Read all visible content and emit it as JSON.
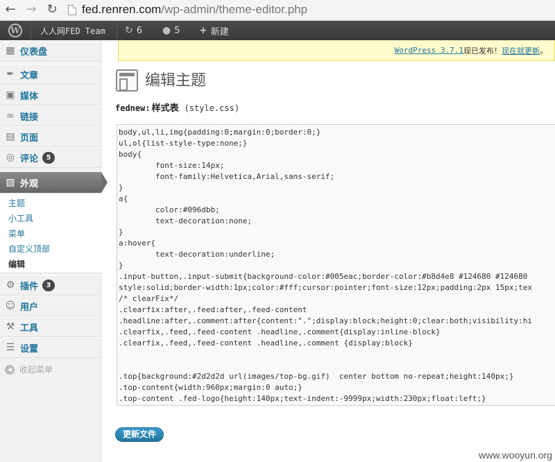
{
  "browser": {
    "url_host": "fed.renren.com",
    "url_path": "/wp-admin/theme-editor.php"
  },
  "adminbar": {
    "logo": "W",
    "site_name": "人人网FED Team",
    "updates_count": "6",
    "comments_count": "5",
    "new_label": "新建"
  },
  "sidebar": {
    "items": [
      {
        "label": "仪表盘"
      },
      {
        "label": "文章"
      },
      {
        "label": "媒体"
      },
      {
        "label": "链接"
      },
      {
        "label": "页面"
      },
      {
        "label": "评论",
        "badge": "5"
      },
      {
        "label": "外观"
      },
      {
        "label": "插件",
        "badge": "3"
      },
      {
        "label": "用户"
      },
      {
        "label": "工具"
      },
      {
        "label": "设置"
      }
    ],
    "submenu": [
      "主题",
      "小工具",
      "菜单",
      "自定义顶部",
      "编辑"
    ],
    "collapse_label": "收起菜单"
  },
  "notice": {
    "version_link": "WordPress 3.7.1",
    "text_mid": " 现已发布！",
    "update_link": "现在就更新",
    "text_end": "。"
  },
  "page": {
    "title": "编辑主题",
    "theme": "fednew:",
    "file_name": "样式表",
    "file_path": "(style.css)"
  },
  "editor": {
    "lines": [
      "body,ul,li,img{padding:0;margin:0;border:0;}",
      "ul,ol{list-style-type:none;}",
      "body{",
      "        font-size:14px;",
      "        font-family:Helvetica,Arial,sans-serif;",
      "}",
      "a{",
      "        color:#096dbb;",
      "        text-decoration:none;",
      "}",
      "a:hover{",
      "        text-decoration:underline;",
      "}",
      ".input-button,.input-submit{background-color:#005eac;border-color:#b8d4e8 #124680 #124680",
      "style:solid;border-width:1px;color:#fff;cursor:pointer;font-size:12px;padding:2px 15px;tex",
      "/* clearFix*/",
      ".clearfix:after,.feed:after,.feed-content",
      ".headline:after,.comment:after{content:\".\";display:block;height:0;clear:both;visibility:hi",
      ".clearfix,.feed,.feed-content .headline,.comment{display:inline-block}",
      ".clearfix,.feed,.feed-content .headline,.comment {display:block}",
      "",
      "",
      ".top{background:#2d2d2d url(images/top-bg.gif)  center bottom no-repeat;height:140px;}",
      ".top-content{width:960px;margin:0 auto;}",
      ".top-content .fed-logo{height:140px;text-indent:-9999px;width:230px;float:left;}"
    ]
  },
  "submit_label": "更新文件",
  "watermark": "www.wooyun.org"
}
